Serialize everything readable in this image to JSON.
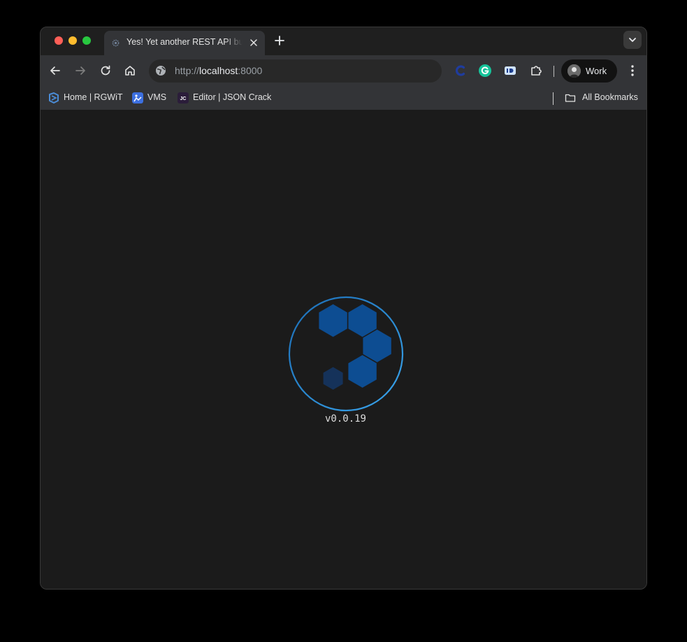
{
  "browser": {
    "tab": {
      "title": "Yes! Yet another REST API builder",
      "favicon": "gear-icon"
    },
    "address": {
      "scheme": "http://",
      "host": "localhost",
      "port": ":8000"
    },
    "extensions": [
      "c-extension-icon",
      "grammarly-icon",
      "id-extension-icon",
      "puzzle-icon"
    ],
    "profile": {
      "name": "Work"
    },
    "bookmarks": [
      {
        "label": "Home | RGWiT",
        "icon": "rgwit-icon"
      },
      {
        "label": "VMS",
        "icon": "vms-icon"
      },
      {
        "label": "Editor | JSON Crack",
        "icon": "jsoncrack-icon"
      }
    ],
    "all_bookmarks": "All Bookmarks"
  },
  "page": {
    "version": "v0.0.19",
    "colors": {
      "accent": "#2e8fd6",
      "hex": "#0d4d92"
    }
  }
}
